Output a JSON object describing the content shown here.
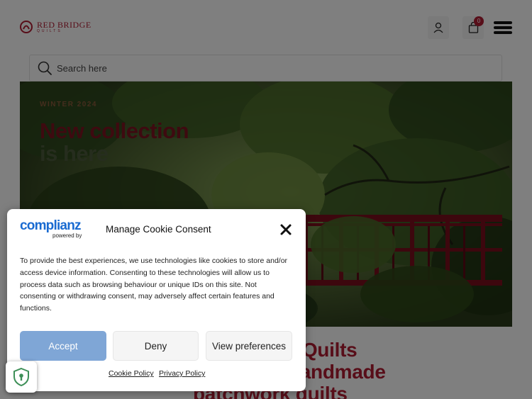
{
  "header": {
    "logo_name": "RED BRIDGE",
    "logo_sub": "QUILTS",
    "cart_count": "0"
  },
  "search": {
    "placeholder": "Search here"
  },
  "hero": {
    "eyebrow": "WINTER 2024",
    "title_line1": "New collection",
    "title_line2": "is here"
  },
  "intro": {
    "line1": "Red Bridge Quilts",
    "line2": "Exclusive handmade",
    "line3": "patchwork quilts"
  },
  "cookie": {
    "brand": "complianz",
    "brand_sub": "powered by",
    "title": "Manage Cookie Consent",
    "body": "To provide the best experiences, we use technologies like cookies to store and/or access device information. Consenting to these technologies will allow us to process data such as browsing behaviour or unique IDs on this site. Not consenting or withdrawing consent, may adversely affect certain features and functions.",
    "accept": "Accept",
    "deny": "Deny",
    "preferences": "View preferences",
    "cookie_policy": "Cookie Policy",
    "privacy_policy": "Privacy Policy"
  },
  "colors": {
    "brand_red": "#b01c33",
    "complianz_blue": "#1a6bd1",
    "accept_button": "#7fa6d6",
    "shield_green": "#3d8f57"
  },
  "icons": [
    "logo-mark-icon",
    "user-icon",
    "cart-icon",
    "menu-icon",
    "search-icon",
    "close-icon",
    "shield-icon"
  ]
}
